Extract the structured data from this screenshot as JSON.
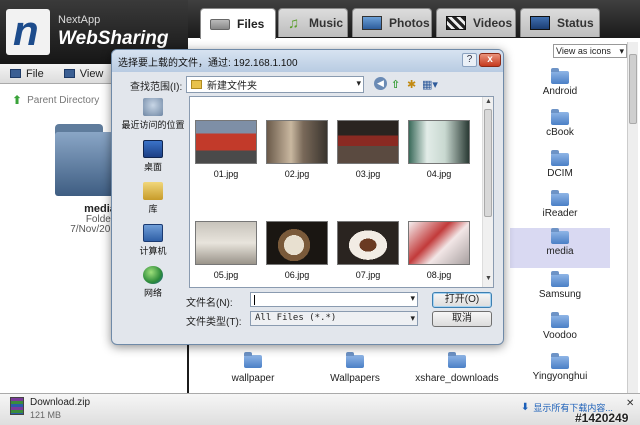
{
  "app": {
    "logo_small": "NextApp",
    "logo_big": "WebSharing",
    "logo_mark": "n"
  },
  "tabs": [
    {
      "label": "Files",
      "icon": "drive-icon"
    },
    {
      "label": "Music",
      "icon": "music-note-icon"
    },
    {
      "label": "Photos",
      "icon": "photo-icon"
    },
    {
      "label": "Videos",
      "icon": "clapperboard-icon"
    },
    {
      "label": "Status",
      "icon": "monitor-icon"
    }
  ],
  "left_menu": {
    "file": "File",
    "view": "View"
  },
  "left_panel": {
    "parent": "Parent Directory",
    "folder_name": "media",
    "folder_type": "Folder",
    "folder_date": "7/Nov/2010 1"
  },
  "view_select": "View as icons",
  "right_folders": [
    "Android",
    "cBook",
    "DCIM",
    "iReader",
    "media",
    "Samsung",
    "Voodoo",
    "Yingyonghui"
  ],
  "bottom_folders": [
    "wallpaper",
    "Wallpapers",
    "xshare_downloads"
  ],
  "download": {
    "name": "Download.zip",
    "size": "121 MB",
    "show_all": "显示所有下载内容..."
  },
  "watermark": "#1420249",
  "dialog": {
    "title": "选择要上载的文件，通过: 192.168.1.100",
    "help": "?",
    "close": "x",
    "lookin_label": "查找范围(I):",
    "lookin_value": "新建文件夹",
    "places": [
      {
        "label": "最近访问的位置",
        "icon": "recent-places-icon"
      },
      {
        "label": "桌面",
        "icon": "desktop-icon"
      },
      {
        "label": "库",
        "icon": "library-icon"
      },
      {
        "label": "计算机",
        "icon": "computer-icon"
      },
      {
        "label": "网络",
        "icon": "network-icon"
      }
    ],
    "files": [
      "01.jpg",
      "02.jpg",
      "03.jpg",
      "04.jpg",
      "05.jpg",
      "06.jpg",
      "07.jpg",
      "08.jpg"
    ],
    "filename_label": "文件名(N):",
    "filename_value": "",
    "filetype_label": "文件类型(T):",
    "filetype_value": "All Files (*.*)",
    "open_button": "打开(O)",
    "cancel_button": "取消"
  }
}
